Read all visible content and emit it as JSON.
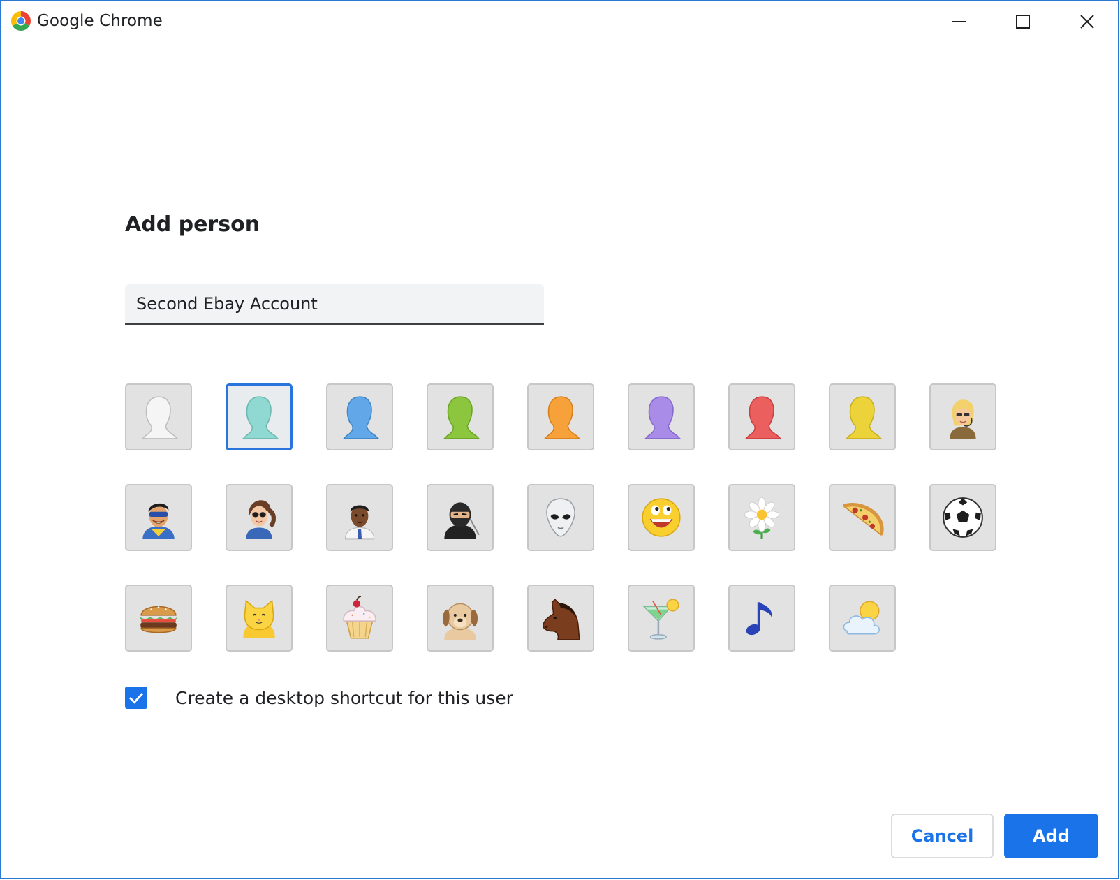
{
  "window": {
    "title": "Google Chrome",
    "icons": {
      "logo": "chrome-logo-icon",
      "minimize": "minimize-icon",
      "maximize": "maximize-icon",
      "close": "close-icon"
    }
  },
  "dialog": {
    "heading": "Add person",
    "name_input": {
      "value": "Second Ebay Account",
      "placeholder": ""
    },
    "avatars": [
      {
        "name": "avatar-white-silhouette",
        "color": "#f5f5f5"
      },
      {
        "name": "avatar-teal-silhouette",
        "color": "#8fd9d2",
        "selected": true
      },
      {
        "name": "avatar-blue-silhouette",
        "color": "#62a8e8"
      },
      {
        "name": "avatar-green-silhouette",
        "color": "#8cc63f"
      },
      {
        "name": "avatar-orange-silhouette",
        "color": "#f7a13a"
      },
      {
        "name": "avatar-purple-silhouette",
        "color": "#a98ce8"
      },
      {
        "name": "avatar-red-silhouette",
        "color": "#ec5f5f"
      },
      {
        "name": "avatar-yellow-silhouette",
        "color": "#ecd33a"
      },
      {
        "name": "avatar-businesswoman"
      },
      {
        "name": "avatar-superhero"
      },
      {
        "name": "avatar-woman-sunglasses"
      },
      {
        "name": "avatar-businessman"
      },
      {
        "name": "avatar-ninja"
      },
      {
        "name": "avatar-alien"
      },
      {
        "name": "avatar-smiley"
      },
      {
        "name": "avatar-flower"
      },
      {
        "name": "avatar-pizza"
      },
      {
        "name": "avatar-soccer-ball"
      },
      {
        "name": "avatar-burger"
      },
      {
        "name": "avatar-cat"
      },
      {
        "name": "avatar-cupcake"
      },
      {
        "name": "avatar-dog"
      },
      {
        "name": "avatar-horse"
      },
      {
        "name": "avatar-cocktail"
      },
      {
        "name": "avatar-music-note"
      },
      {
        "name": "avatar-sun-cloud"
      }
    ],
    "shortcut": {
      "label": "Create a desktop shortcut for this user",
      "checked": true
    },
    "buttons": {
      "cancel": "Cancel",
      "add": "Add"
    }
  },
  "colors": {
    "accent": "#1a73e8",
    "window_border": "#2b78d2"
  }
}
